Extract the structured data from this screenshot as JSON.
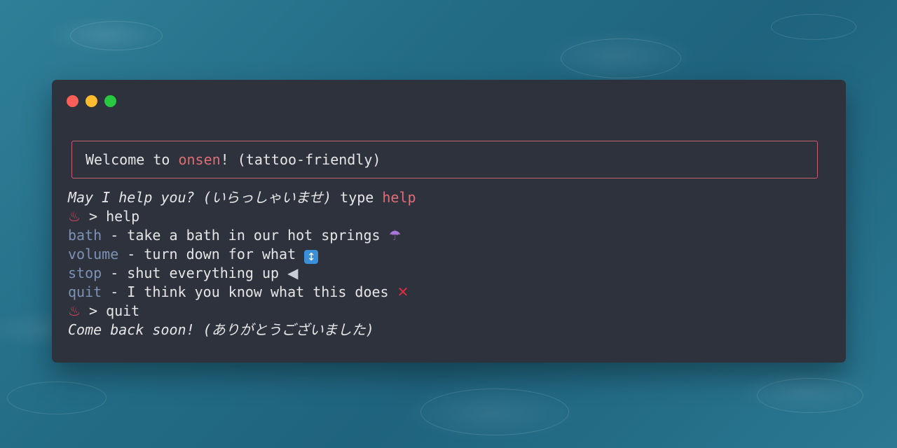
{
  "window": {
    "controls": [
      {
        "name": "close",
        "color": "#fd5e57"
      },
      {
        "name": "minimize",
        "color": "#febc2e"
      },
      {
        "name": "maximize",
        "color": "#28c840"
      }
    ]
  },
  "banner": {
    "prefix": "Welcome to ",
    "app_name": "onsen",
    "suffix": "! (tattoo-friendly)"
  },
  "terminal": {
    "greeting": "May I help you? (いらっしゃいませ)",
    "greeting_tail": " type ",
    "help_word": "help",
    "prompt_icon": "♨",
    "prompt1_symbol": " > ",
    "prompt1_cmd": "help",
    "commands": [
      {
        "name": "bath",
        "sep": " - ",
        "desc": "take a bath in our hot springs ",
        "icon": "☂"
      },
      {
        "name": "volume",
        "sep": " - ",
        "desc": "turn down for what ",
        "icon": "↕"
      },
      {
        "name": "stop",
        "sep": " - ",
        "desc": "shut everything up ",
        "icon": "◀"
      },
      {
        "name": "quit",
        "sep": " - ",
        "desc": "I think you know what this does ",
        "icon": "✕"
      }
    ],
    "prompt2_symbol": " > ",
    "prompt2_cmd": "quit",
    "farewell": "Come back soon! (ありがとうございました)"
  },
  "colors": {
    "window_bg": "#2e323d",
    "accent": "#e06c75",
    "command": "#7c92b5",
    "text": "#e6e6e6",
    "banner_border": "#c0616c"
  }
}
